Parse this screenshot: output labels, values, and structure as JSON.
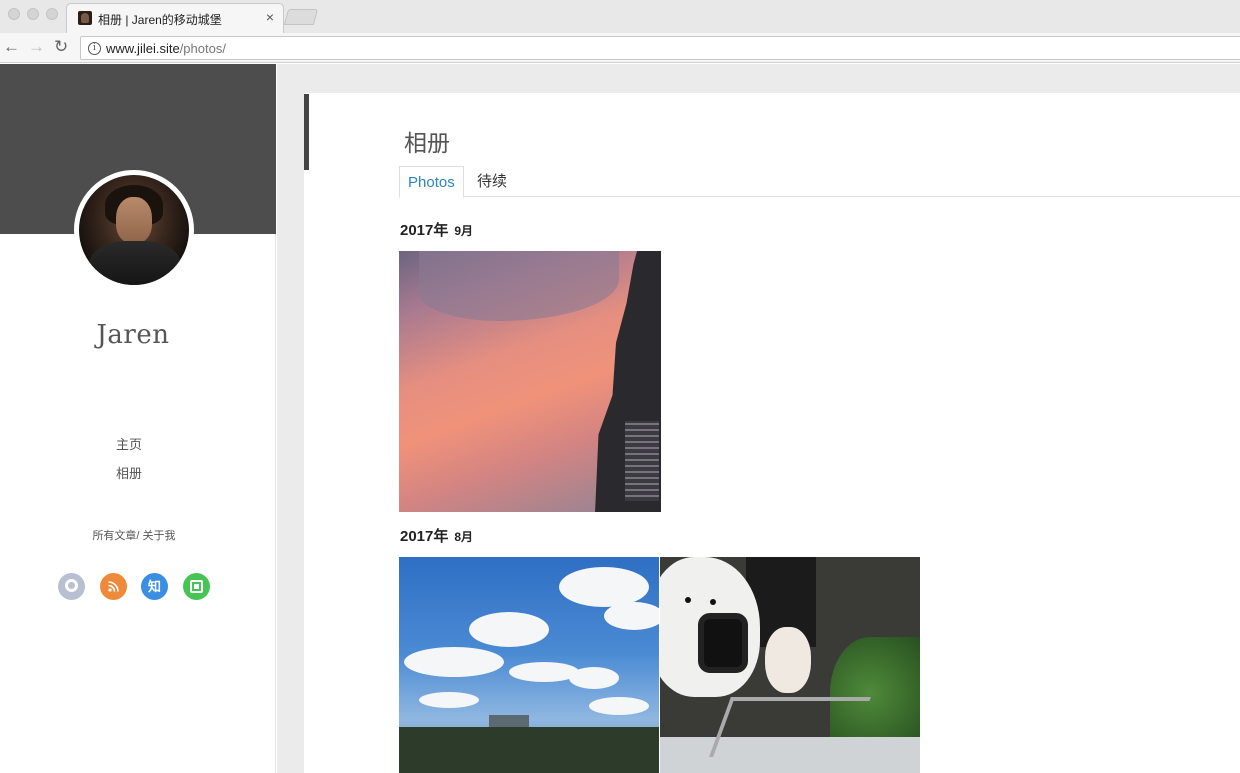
{
  "browser": {
    "tab_title": "相册 | Jaren的移动城堡",
    "close_glyph": "×",
    "url_host": "www.jilei.site",
    "url_path": "/photos/"
  },
  "sidebar": {
    "author": "Jaren",
    "nav": [
      {
        "label": "主页"
      },
      {
        "label": "相册"
      }
    ],
    "links": "所有文章/ 关于我",
    "social": [
      {
        "name": "github",
        "glyph": "",
        "color": "#b7bfd0"
      },
      {
        "name": "rss",
        "glyph": "",
        "color": "#ef8a3b"
      },
      {
        "name": "zhihu",
        "glyph": "知",
        "color": "#3b8fe3"
      },
      {
        "name": "douban",
        "glyph": "",
        "color": "#46c455"
      }
    ]
  },
  "main": {
    "page_title": "相册",
    "tabs": [
      {
        "label": "Photos",
        "active": true
      },
      {
        "label": "待续",
        "active": false
      }
    ],
    "groups": [
      {
        "year": "2017年",
        "month": "9月",
        "photos": [
          "sunset-sky-building"
        ]
      },
      {
        "year": "2017年",
        "month": "8月",
        "photos": [
          "blue-sky-clouds",
          "white-dogs-scooter"
        ]
      }
    ]
  },
  "colors": {
    "accent": "#2a86c5",
    "banner": "#4d4d4d"
  }
}
